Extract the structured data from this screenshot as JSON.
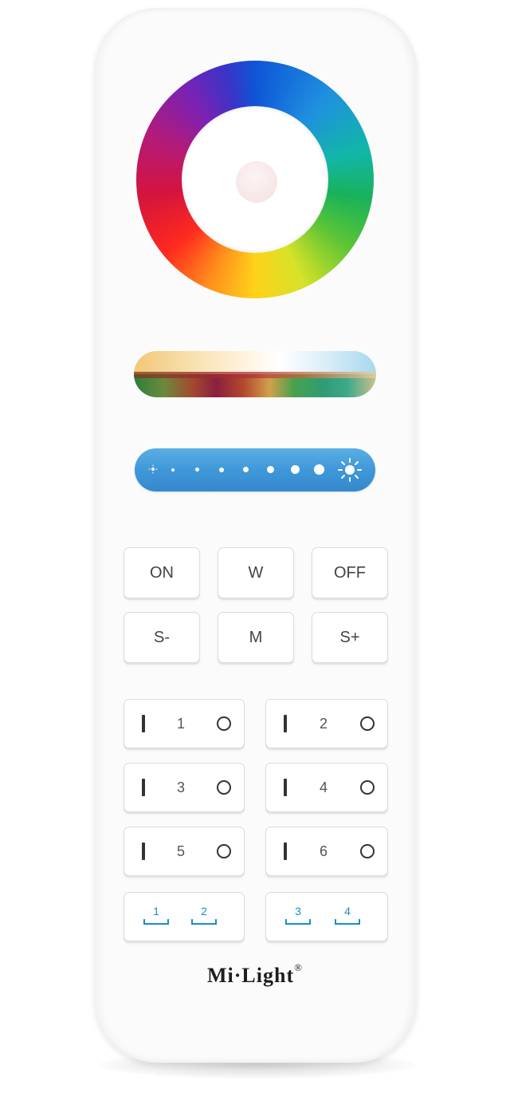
{
  "device": {
    "brand": "Mi·Light",
    "brand_mark": "®",
    "body_color": "#fbfbfb",
    "accent_color": "#3f98d9"
  },
  "controls": {
    "color_wheel_icon": "color-wheel",
    "brightness_icons": {
      "low": "moon-icon",
      "high": "sun-icon"
    },
    "row1": [
      "ON",
      "W",
      "OFF"
    ],
    "row2": [
      "S-",
      "M",
      "S+"
    ],
    "zones": [
      "1",
      "2",
      "3",
      "4",
      "5",
      "6"
    ],
    "scenes": [
      "1",
      "2",
      "3",
      "4"
    ]
  }
}
